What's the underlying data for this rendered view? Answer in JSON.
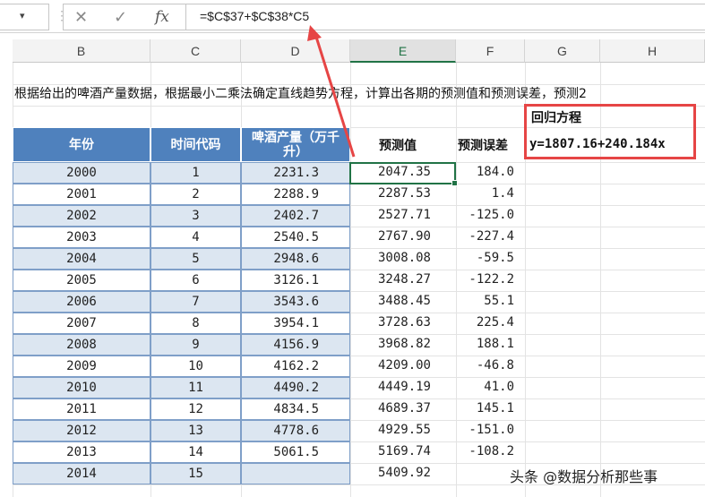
{
  "formula_bar": {
    "cancel_icon": "close-icon",
    "enter_icon": "checkmark-icon",
    "fx_label": "fx",
    "formula": "=$C$37+$C$38*C5"
  },
  "column_headers": [
    "B",
    "C",
    "D",
    "E",
    "F",
    "G",
    "H"
  ],
  "selected_column": "E",
  "note_text": "根据给出的啤酒产量数据，根据最小二乘法确定直线趋势方程，计算出各期的预测值和预测误差，预测2",
  "table": {
    "headers": [
      "年份",
      "时间代码",
      "啤酒产量（万千升）",
      "预测值",
      "预测误差"
    ],
    "rows": [
      [
        "2000",
        "1",
        "2231.3",
        "2047.35",
        "184.0"
      ],
      [
        "2001",
        "2",
        "2288.9",
        "2287.53",
        "1.4"
      ],
      [
        "2002",
        "3",
        "2402.7",
        "2527.71",
        "-125.0"
      ],
      [
        "2003",
        "4",
        "2540.5",
        "2767.90",
        "-227.4"
      ],
      [
        "2004",
        "5",
        "2948.6",
        "3008.08",
        "-59.5"
      ],
      [
        "2005",
        "6",
        "3126.1",
        "3248.27",
        "-122.2"
      ],
      [
        "2006",
        "7",
        "3543.6",
        "3488.45",
        "55.1"
      ],
      [
        "2007",
        "8",
        "3954.1",
        "3728.63",
        "225.4"
      ],
      [
        "2008",
        "9",
        "4156.9",
        "3968.82",
        "188.1"
      ],
      [
        "2009",
        "10",
        "4162.2",
        "4209.00",
        "-46.8"
      ],
      [
        "2010",
        "11",
        "4490.2",
        "4449.19",
        "41.0"
      ],
      [
        "2011",
        "12",
        "4834.5",
        "4689.37",
        "145.1"
      ],
      [
        "2012",
        "13",
        "4778.6",
        "4929.55",
        "-151.0"
      ],
      [
        "2013",
        "14",
        "5061.5",
        "5169.74",
        "-108.2"
      ],
      [
        "2014",
        "15",
        "",
        "5409.92",
        ""
      ]
    ]
  },
  "regression": {
    "title": "回归方程",
    "equation": "y=1807.16+240.184x"
  },
  "colors": {
    "header_blue": "#4f81bd",
    "stripe": "#dce6f1",
    "highlight_red": "#e64545",
    "excel_green": "#217346"
  },
  "watermark": "头条 @数据分析那些事"
}
